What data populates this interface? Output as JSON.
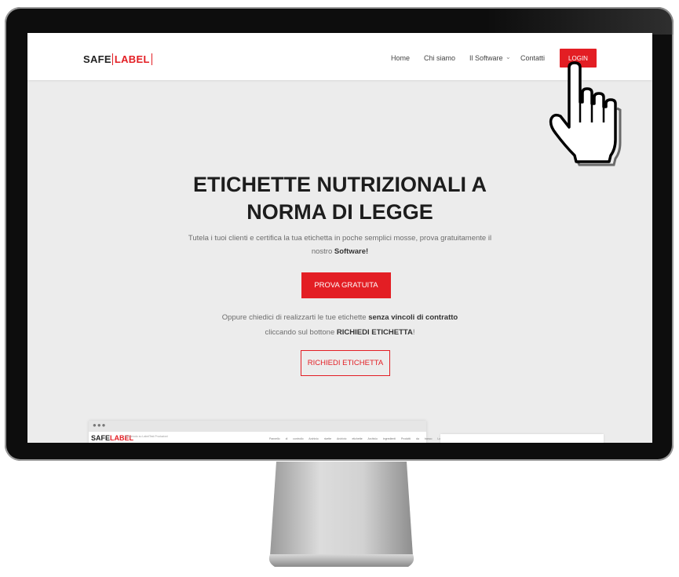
{
  "logo": {
    "word1": "SAFE",
    "word2": "LABEL"
  },
  "nav": {
    "items": [
      {
        "label": "Home"
      },
      {
        "label": "Chi siamo"
      },
      {
        "label": "Il Software"
      },
      {
        "label": "Contatti"
      }
    ],
    "dropdown_icon": "chevron-down-icon",
    "login_label": "LOGIN"
  },
  "hero": {
    "title_line1": "ETICHETTE NUTRIZIONALI A",
    "title_line2": "NORMA DI LEGGE",
    "subtitle_part1": "Tutela i tuoi clienti e certifica la tua etichetta in poche semplici mosse, prova gratuitamente il",
    "subtitle_part2": "nostro",
    "subtitle_bold": "Software!",
    "cta_primary": "PROVA GRATUITA",
    "alt_part1": "Oppure chiedici di realizzarti le tue etichette",
    "alt_bold1": "senza vincoli di contratto",
    "alt_part2": "cliccando sul bottone",
    "alt_bold2": "RICHIEDI ETICHETTA",
    "alt_part3": "!",
    "cta_secondary": "RICHIEDI ETICHETTA"
  },
  "preview": {
    "dots": "●●●",
    "logo_word1": "SAFE",
    "logo_word2": "LABEL",
    "welcome": "Benvenuto su LabelTest Produzioni",
    "menu": "Pannello di controllo  Archivio ricette  Archivio etichette  Archivio ingredienti  Prodotti da banco  Logout"
  },
  "colors": {
    "accent": "#e31e24",
    "background": "#ececec",
    "text": "#1d1d1d"
  },
  "icons": {
    "cursor": "hand-pointer-icon"
  }
}
